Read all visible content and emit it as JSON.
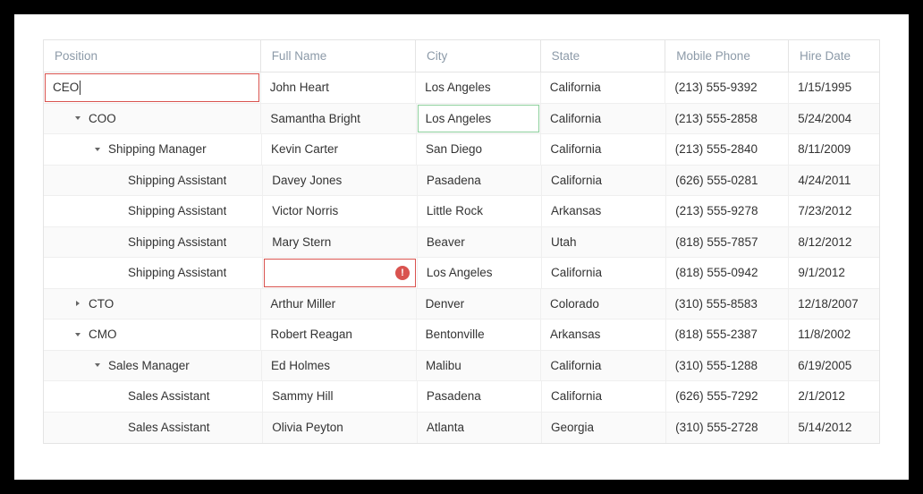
{
  "columns": {
    "position": "Position",
    "fullName": "Full Name",
    "city": "City",
    "state": "State",
    "mobile": "Mobile Phone",
    "hireDate": "Hire Date"
  },
  "editingValue": "CEO",
  "rows": [
    {
      "depth": 0,
      "expander": "none",
      "position": "CEO",
      "name": "John Heart",
      "city": "Los Angeles",
      "state": "California",
      "phone": "(213) 555-9392",
      "date": "1/15/1995",
      "positionEdit": true
    },
    {
      "depth": 1,
      "expander": "down",
      "position": "COO",
      "name": "Samantha Bright",
      "city": "Los Angeles",
      "state": "California",
      "phone": "(213) 555-2858",
      "date": "5/24/2004",
      "cityHighlight": true
    },
    {
      "depth": 2,
      "expander": "down",
      "position": "Shipping Manager",
      "name": "Kevin Carter",
      "city": "San Diego",
      "state": "California",
      "phone": "(213) 555-2840",
      "date": "8/11/2009"
    },
    {
      "depth": 3,
      "expander": "none",
      "position": "Shipping Assistant",
      "name": "Davey Jones",
      "city": "Pasadena",
      "state": "California",
      "phone": "(626) 555-0281",
      "date": "4/24/2011"
    },
    {
      "depth": 3,
      "expander": "none",
      "position": "Shipping Assistant",
      "name": "Victor Norris",
      "city": "Little Rock",
      "state": "Arkansas",
      "phone": "(213) 555-9278",
      "date": "7/23/2012"
    },
    {
      "depth": 3,
      "expander": "none",
      "position": "Shipping Assistant",
      "name": "Mary Stern",
      "city": "Beaver",
      "state": "Utah",
      "phone": "(818) 555-7857",
      "date": "8/12/2012"
    },
    {
      "depth": 3,
      "expander": "none",
      "position": "Shipping Assistant",
      "name": "",
      "city": "Los Angeles",
      "state": "California",
      "phone": "(818) 555-0942",
      "date": "9/1/2012",
      "nameError": true
    },
    {
      "depth": 1,
      "expander": "right",
      "position": "CTO",
      "name": "Arthur Miller",
      "city": "Denver",
      "state": "Colorado",
      "phone": "(310) 555-8583",
      "date": "12/18/2007"
    },
    {
      "depth": 1,
      "expander": "down",
      "position": "CMO",
      "name": "Robert Reagan",
      "city": "Bentonville",
      "state": "Arkansas",
      "phone": "(818) 555-2387",
      "date": "11/8/2002"
    },
    {
      "depth": 2,
      "expander": "down",
      "position": "Sales Manager",
      "name": "Ed Holmes",
      "city": "Malibu",
      "state": "California",
      "phone": "(310) 555-1288",
      "date": "6/19/2005"
    },
    {
      "depth": 3,
      "expander": "none",
      "position": "Sales Assistant",
      "name": "Sammy Hill",
      "city": "Pasadena",
      "state": "California",
      "phone": "(626) 555-7292",
      "date": "2/1/2012"
    },
    {
      "depth": 3,
      "expander": "none",
      "position": "Sales Assistant",
      "name": "Olivia Peyton",
      "city": "Atlanta",
      "state": "Georgia",
      "phone": "(310) 555-2728",
      "date": "5/14/2012"
    }
  ]
}
